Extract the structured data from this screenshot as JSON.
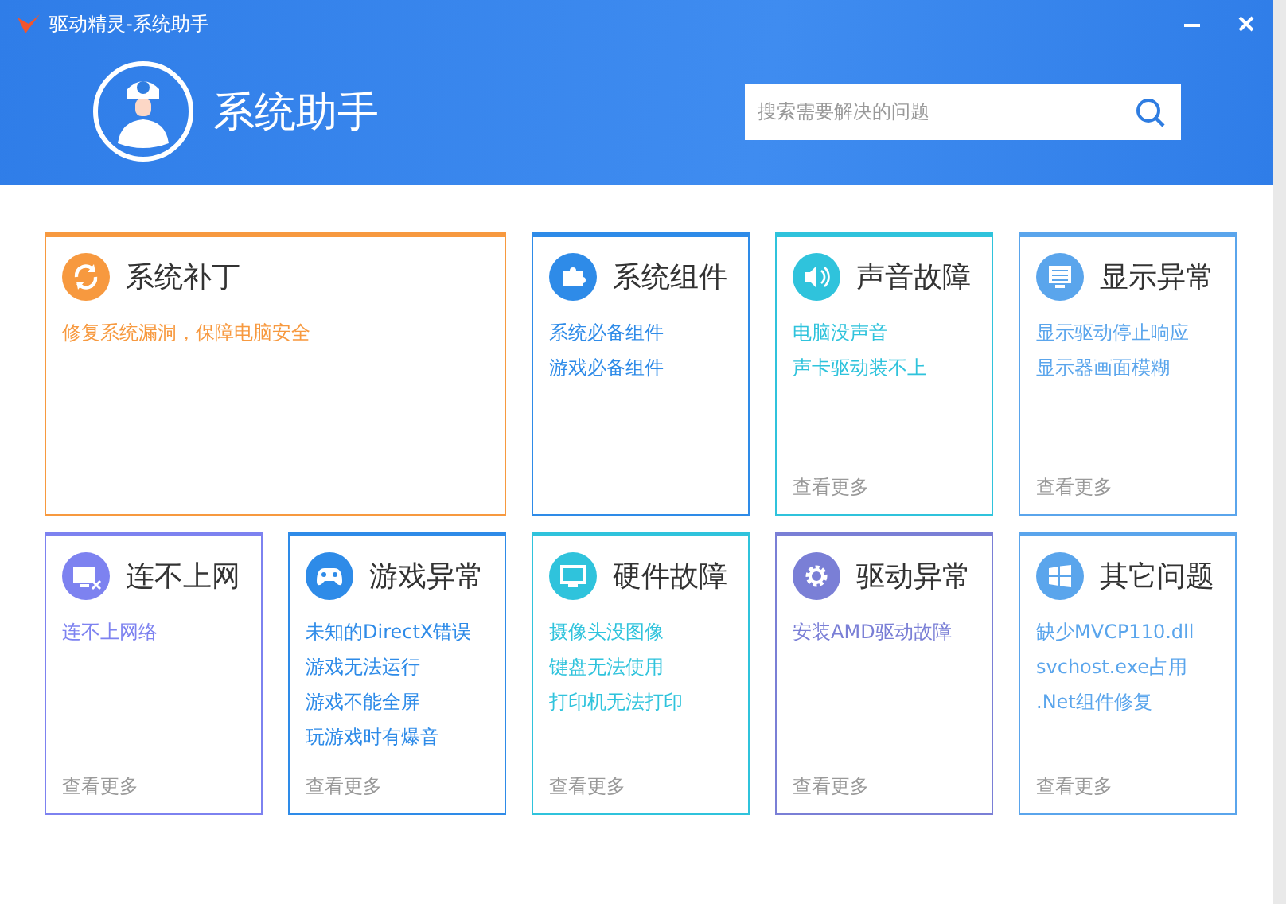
{
  "window": {
    "title": "驱动精灵-系统助手"
  },
  "header": {
    "title": "系统助手"
  },
  "search": {
    "placeholder": "搜索需要解决的问题"
  },
  "cards": [
    {
      "kind": "wide",
      "title": "系统补丁",
      "color": "#f7993f",
      "links": [
        "修复系统漏洞，保障电脑安全"
      ]
    },
    {
      "kind": "normal",
      "title": "系统组件",
      "color": "#2e8be8",
      "links": [
        "系统必备组件",
        "游戏必备组件"
      ]
    },
    {
      "kind": "normal",
      "title": "声音故障",
      "color": "#2fc3dc",
      "links": [
        "电脑没声音",
        "声卡驱动装不上"
      ],
      "more": "查看更多"
    },
    {
      "kind": "normal",
      "title": "显示异常",
      "color": "#5aa5ec",
      "links": [
        "显示驱动停止响应",
        "显示器画面模糊"
      ],
      "more": "查看更多"
    },
    {
      "kind": "normal",
      "title": "连不上网",
      "color": "#7d82f0",
      "links": [
        "连不上网络"
      ],
      "more": "查看更多"
    },
    {
      "kind": "normal",
      "title": "游戏异常",
      "color": "#2e8be8",
      "links": [
        "未知的DirectX错误",
        "游戏无法运行",
        "游戏不能全屏",
        "玩游戏时有爆音"
      ],
      "more": "查看更多"
    },
    {
      "kind": "normal",
      "title": "硬件故障",
      "color": "#2fc3dc",
      "links": [
        "摄像头没图像",
        "键盘无法使用",
        "打印机无法打印"
      ],
      "more": "查看更多"
    },
    {
      "kind": "normal",
      "title": "驱动异常",
      "color": "#7a7fd6",
      "links": [
        "安装AMD驱动故障"
      ],
      "more": "查看更多"
    },
    {
      "kind": "normal",
      "title": "其它问题",
      "color": "#5aa5ec",
      "links": [
        "缺少MVCP110.dll",
        "svchost.exe占用",
        ".Net组件修复"
      ],
      "more": "查看更多"
    }
  ]
}
